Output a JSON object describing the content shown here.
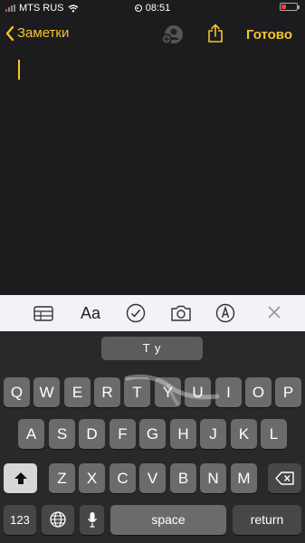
{
  "status": {
    "carrier": "MTS RUS",
    "time": "08:51"
  },
  "nav": {
    "back_label": "Заметки",
    "done_label": "Готово"
  },
  "note": {
    "text": ""
  },
  "toolbar": {
    "format_label": "Aa"
  },
  "keyboard": {
    "suggestion": "T y",
    "row1": [
      "Q",
      "W",
      "E",
      "R",
      "T",
      "Y",
      "U",
      "I",
      "O",
      "P"
    ],
    "row2": [
      "A",
      "S",
      "D",
      "F",
      "G",
      "H",
      "J",
      "K",
      "L"
    ],
    "row3": [
      "Z",
      "X",
      "C",
      "V",
      "B",
      "N",
      "M"
    ],
    "numbers_label": "123",
    "space_label": "space",
    "return_label": "return"
  },
  "colors": {
    "accent": "#f4c430",
    "background": "#1c1c1e",
    "toolbar": "#f2f2f7"
  },
  "icons": [
    "wifi-icon",
    "record-icon",
    "battery-icon",
    "chevron-left-icon",
    "collaborator-icon",
    "share-icon",
    "table-icon",
    "checklist-icon",
    "camera-icon",
    "markup-icon",
    "close-icon",
    "shift-icon",
    "delete-icon",
    "globe-icon",
    "mic-icon"
  ]
}
